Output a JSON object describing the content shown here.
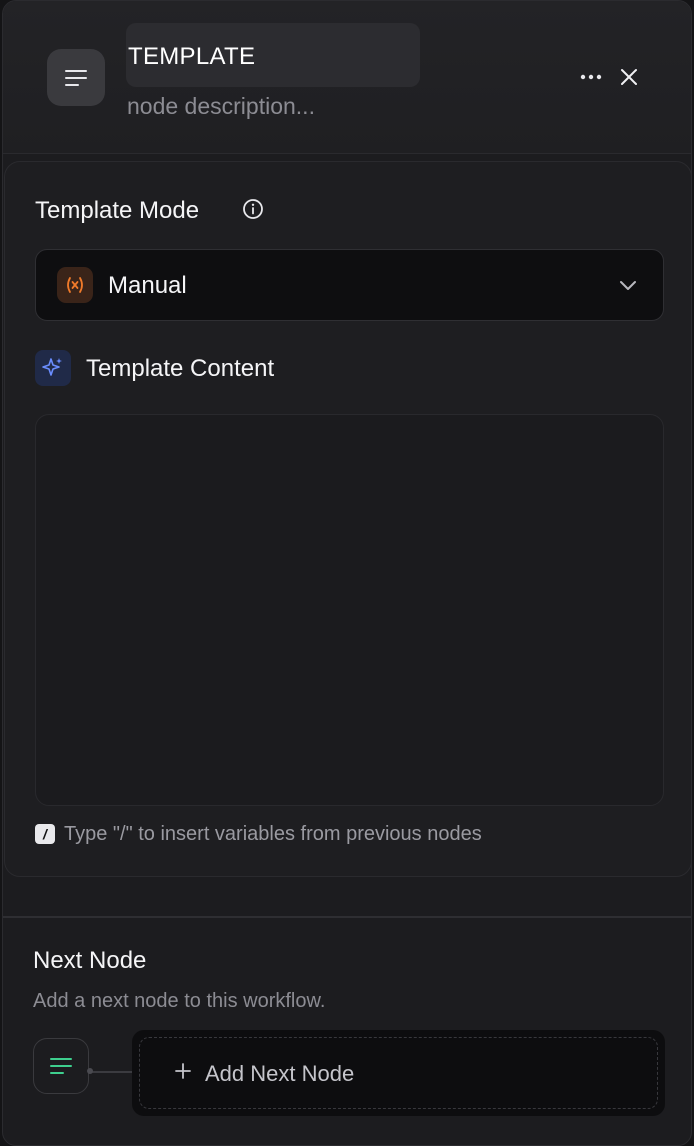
{
  "header": {
    "title": "TEMPLATE",
    "description_placeholder": "node description...",
    "node_icon": "align-left-icon",
    "more_icon": "more-horizontal-icon",
    "close_icon": "close-icon"
  },
  "template_mode": {
    "label": "Template Mode",
    "info_icon": "info-icon",
    "selected": "Manual",
    "selected_icon": "variable-icon",
    "dropdown_icon": "chevron-down-icon"
  },
  "template_content": {
    "label": "Template Content",
    "icon": "sparkle-icon",
    "value": "",
    "hint_key": "/",
    "hint": "Type \"/\" to insert variables from previous nodes"
  },
  "next_node": {
    "title": "Next Node",
    "description": "Add a next node to this workflow.",
    "node_icon": "align-left-icon",
    "add_icon": "plus-icon",
    "add_label": "Add Next Node"
  },
  "colors": {
    "panel_bg": "#1c1c1f",
    "accent_orange": "#f07a2a",
    "accent_blue": "#6a8dff",
    "accent_green": "#3ecf8e"
  }
}
